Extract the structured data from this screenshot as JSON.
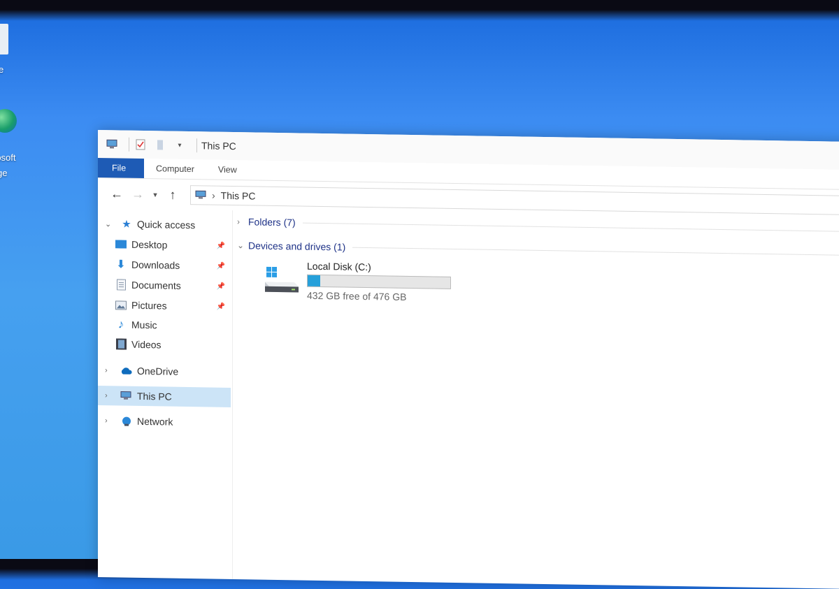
{
  "desktop": {
    "icons": [
      {
        "label": "e"
      },
      {
        "label": "rosoft"
      },
      {
        "label": "ge"
      }
    ]
  },
  "window": {
    "title": "This PC",
    "ribbon_tabs": [
      "File",
      "Computer",
      "View"
    ],
    "address": {
      "location": "This PC"
    },
    "nav_pane": {
      "quick_access": "Quick access",
      "items": [
        {
          "label": "Desktop",
          "pinned": true
        },
        {
          "label": "Downloads",
          "pinned": true
        },
        {
          "label": "Documents",
          "pinned": true
        },
        {
          "label": "Pictures",
          "pinned": true
        },
        {
          "label": "Music",
          "pinned": false
        },
        {
          "label": "Videos",
          "pinned": false
        }
      ],
      "onedrive": "OneDrive",
      "this_pc": "This PC",
      "network": "Network"
    },
    "content": {
      "folders_header": "Folders (7)",
      "devices_header": "Devices and drives (1)",
      "drive": {
        "name": "Local Disk (C:)",
        "free_text": "432 GB free of 476 GB",
        "used_fraction": 0.09
      }
    },
    "colors": {
      "accent": "#1e5bb5",
      "selection": "#cce4f7",
      "drive_fill": "#26a0da",
      "header_text": "#1e3287"
    }
  }
}
